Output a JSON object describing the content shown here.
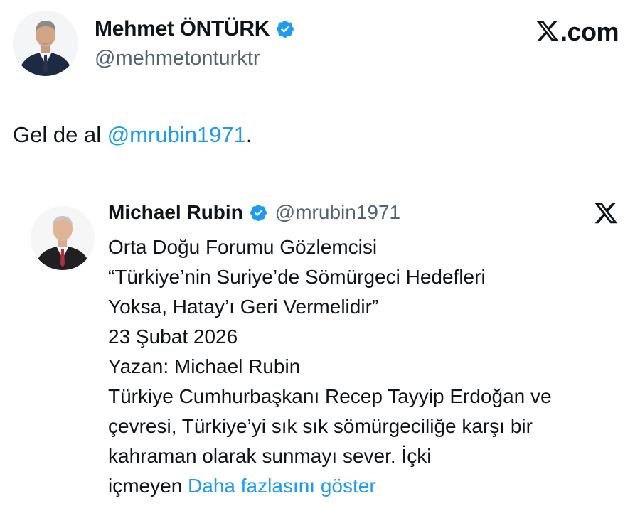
{
  "tweet": {
    "author": {
      "name": "Mehmet ÖNTÜRK",
      "handle": "@mehmetonturktr",
      "verified": true,
      "avatar_icon": "profile-photo"
    },
    "brand": {
      "logo_icon": "x-logo-icon",
      "text": ".com"
    },
    "text_prefix": "Gel de al ",
    "mention": "@mrubin1971",
    "text_suffix": "."
  },
  "quoted_tweet": {
    "author": {
      "name": "Michael Rubin",
      "handle": "@mrubin1971",
      "verified": true,
      "avatar_icon": "profile-photo"
    },
    "platform_icon": "x-logo-icon",
    "lines": [
      "Orta Doğu Forumu Gözlemcisi",
      "“Türkiye’nin Suriye’de Sömürgeci Hedefleri",
      "Yoksa, Hatay’ı Geri Vermelidir”",
      "23 Şubat 2026",
      "Yazan: Michael Rubin",
      "Türkiye Cumhurbaşkanı Recep Tayyip Erdoğan ve",
      "çevresi, Türkiye’yi sık sık sömürgeciliğe karşı bir",
      "kahraman olarak sunmayı sever. İçki"
    ],
    "last_line_prefix": "içmeyen ",
    "show_more_label": "Daha fazlasını göster"
  },
  "colors": {
    "text": "#0f1419",
    "secondary": "#536471",
    "link": "#1d9bf0",
    "verified": "#1d9bf0"
  }
}
